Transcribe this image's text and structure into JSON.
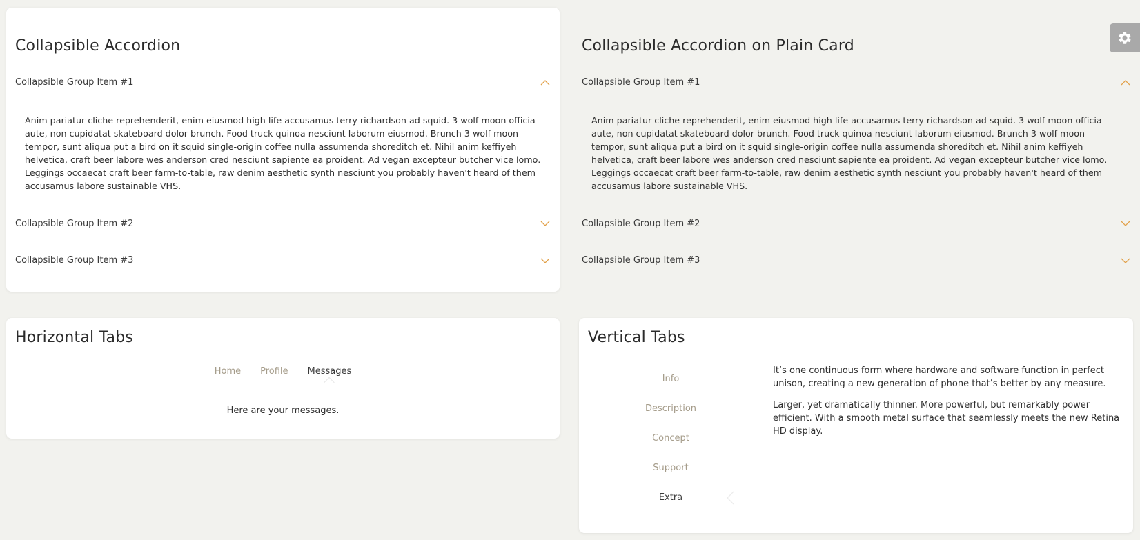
{
  "accordion_card": {
    "title": "Collapsible Accordion",
    "items": [
      {
        "label": "Collapsible Group Item #1",
        "expanded": true,
        "body": "Anim pariatur cliche reprehenderit, enim eiusmod high life accusamus terry richardson ad squid. 3 wolf moon officia aute, non cupidatat skateboard dolor brunch. Food truck quinoa nesciunt laborum eiusmod. Brunch 3 wolf moon tempor, sunt aliqua put a bird on it squid single-origin coffee nulla assumenda shoreditch et. Nihil anim keffiyeh helvetica, craft beer labore wes anderson cred nesciunt sapiente ea proident. Ad vegan excepteur butcher vice lomo. Leggings occaecat craft beer farm-to-table, raw denim aesthetic synth nesciunt you probably haven't heard of them accusamus labore sustainable VHS."
      },
      {
        "label": "Collapsible Group Item #2",
        "expanded": false
      },
      {
        "label": "Collapsible Group Item #3",
        "expanded": false
      }
    ]
  },
  "plain_accordion": {
    "title": "Collapsible Accordion on Plain Card",
    "items": [
      {
        "label": "Collapsible Group Item #1",
        "expanded": true,
        "body": "Anim pariatur cliche reprehenderit, enim eiusmod high life accusamus terry richardson ad squid. 3 wolf moon officia aute, non cupidatat skateboard dolor brunch. Food truck quinoa nesciunt laborum eiusmod. Brunch 3 wolf moon tempor, sunt aliqua put a bird on it squid single-origin coffee nulla assumenda shoreditch et. Nihil anim keffiyeh helvetica, craft beer labore wes anderson cred nesciunt sapiente ea proident. Ad vegan excepteur butcher vice lomo. Leggings occaecat craft beer farm-to-table, raw denim aesthetic synth nesciunt you probably haven't heard of them accusamus labore sustainable VHS."
      },
      {
        "label": "Collapsible Group Item #2",
        "expanded": false
      },
      {
        "label": "Collapsible Group Item #3",
        "expanded": false
      }
    ]
  },
  "horizontal_tabs": {
    "title": "Horizontal Tabs",
    "tabs": [
      "Home",
      "Profile",
      "Messages"
    ],
    "active": "Messages",
    "content": "Here are your messages."
  },
  "vertical_tabs": {
    "title": "Vertical Tabs",
    "tabs": [
      "Info",
      "Description",
      "Concept",
      "Support",
      "Extra"
    ],
    "active": "Extra",
    "paragraphs": [
      "It’s one continuous form where hardware and software function in perfect unison, creating a new generation of phone that’s better by any measure.",
      "Larger, yet dramatically thinner. More powerful, but remarkably power efficient. With a smooth metal surface that seamlessly meets the new Retina HD display."
    ]
  },
  "settings_button": {
    "icon": "gear-icon"
  },
  "colors": {
    "accent": "#e2a14a",
    "tab_inactive": "#a59c8a",
    "background": "#f2f2ee"
  }
}
